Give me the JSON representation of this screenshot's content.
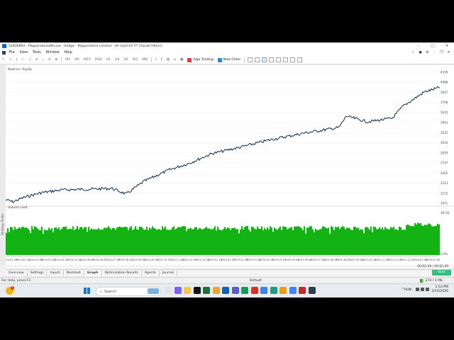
{
  "window": {
    "title": "52836892 - PepperstoneUK-Live : Hedge - Pepperstone Limited - [AI Gold EA YT Claude Filters]",
    "minimize": "–",
    "maximize": "□",
    "close": "✕"
  },
  "menu": {
    "items": [
      "File",
      "View",
      "Tools",
      "Window",
      "Help"
    ]
  },
  "toolbar": {
    "timeframes": [
      "M1",
      "M5",
      "M15",
      "M30",
      "H1",
      "H4",
      "D1",
      "W1",
      "MN"
    ],
    "algo_trading": "Algo Trading",
    "new_order": "New Order",
    "colors": {
      "algo": "#e53935",
      "order": "#1e88e5"
    }
  },
  "chart": {
    "legend": "Balance / Equity",
    "subwindow_label": "Deposit Load",
    "line_color": "#0b2b4d",
    "fill_color": "#12b312",
    "y_ticks": [
      "4339",
      "4088",
      "3937",
      "3706",
      "3475",
      "3453",
      "3222",
      "3010",
      "2879",
      "2737",
      "2425",
      "2313",
      "2122",
      "1971"
    ],
    "load_ticks": [
      "18.3%",
      "0.0%"
    ],
    "x_ticks": [
      "2024.01.19",
      "2024.02.13",
      "2024.03.06",
      "2024.03.28",
      "2024.04.22",
      "2024.05.14",
      "2024.06.05",
      "2024.06.27",
      "2024.07.19",
      "2024.08.12",
      "2024.09.03",
      "2024.09.25",
      "2024.10.17",
      "2024.11.08",
      "2024.12.02",
      "2024.12.24",
      "2025.01.15",
      "2025.02.07",
      "2025.02.28",
      "2025.03.24",
      "2025.04.15",
      "2025.05.07",
      "2025.05.29",
      "2025.06.20",
      "2025.07.14",
      "2025.08.05",
      "2025.08.27",
      "2025.09.18",
      "2025.10.10",
      "2025.11.03",
      "2025.11.25",
      "2025.12.17",
      "2026.01.09",
      "2026.01.30"
    ]
  },
  "strategy_tester_label": "Strategy Tester",
  "tabs": {
    "items": [
      "Overview",
      "Settings",
      "Inputs",
      "Backtest",
      "Graph",
      "Optimization Results",
      "Agents",
      "Journal"
    ],
    "active": "Graph",
    "start": "Start",
    "timer": "00:02:49 / 00:02:49"
  },
  "statusbar": {
    "help": "For Help, press F1",
    "profile": "Default",
    "net": "374 / 4 Mb"
  },
  "taskbar": {
    "badge": "1",
    "search_placeholder": "Search",
    "lang": "HUN",
    "time": "1:53 PM",
    "date": "2/15/2026",
    "chevron": "^"
  }
}
